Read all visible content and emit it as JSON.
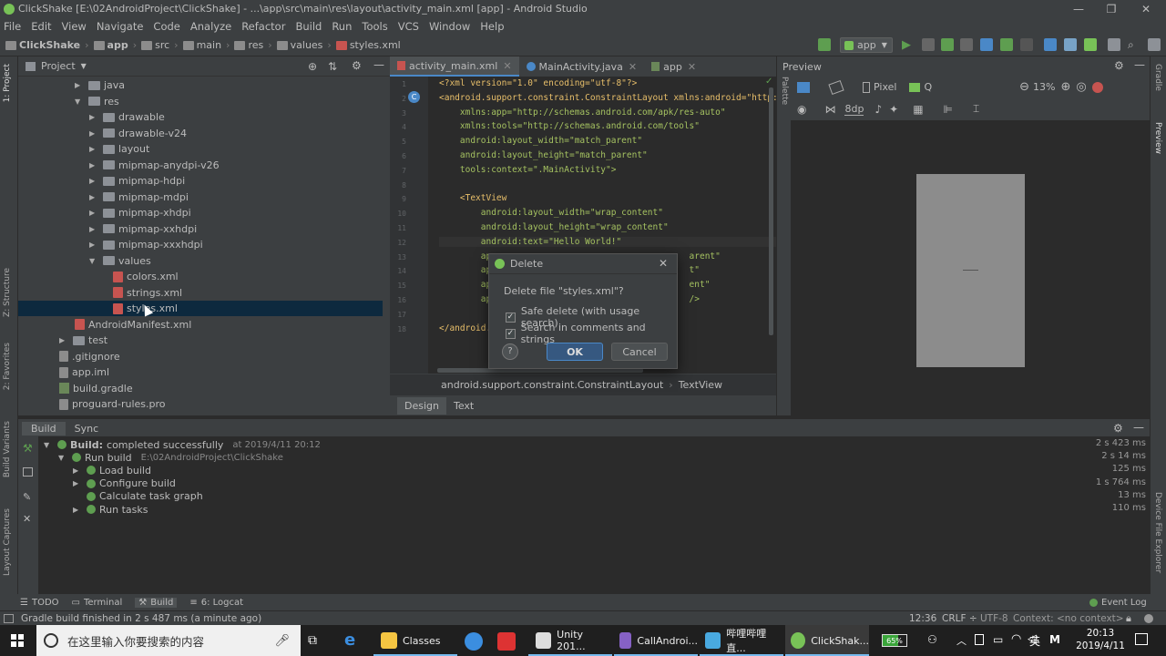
{
  "window": {
    "title": "ClickShake [E:\\02AndroidProject\\ClickShake] - ...\\app\\src\\main\\res\\layout\\activity_main.xml [app] - Android Studio",
    "minimize": "—",
    "maximize": "❐",
    "close": "✕"
  },
  "menu": [
    "File",
    "Edit",
    "View",
    "Navigate",
    "Code",
    "Analyze",
    "Refactor",
    "Build",
    "Run",
    "Tools",
    "VCS",
    "Window",
    "Help"
  ],
  "breadcrumbs": [
    "ClickShake",
    "app",
    "src",
    "main",
    "res",
    "values",
    "styles.xml"
  ],
  "run_config": "app",
  "project_panel": {
    "title": "Project",
    "tree": [
      {
        "label": "java",
        "kind": "folder",
        "depth": 4,
        "expanded": false
      },
      {
        "label": "res",
        "kind": "folder",
        "depth": 4,
        "expanded": true
      },
      {
        "label": "drawable",
        "kind": "folder",
        "depth": 5,
        "expanded": false
      },
      {
        "label": "drawable-v24",
        "kind": "folder",
        "depth": 5,
        "expanded": false
      },
      {
        "label": "layout",
        "kind": "folder",
        "depth": 5,
        "expanded": false
      },
      {
        "label": "mipmap-anydpi-v26",
        "kind": "folder",
        "depth": 5,
        "expanded": false
      },
      {
        "label": "mipmap-hdpi",
        "kind": "folder",
        "depth": 5,
        "expanded": false
      },
      {
        "label": "mipmap-mdpi",
        "kind": "folder",
        "depth": 5,
        "expanded": false
      },
      {
        "label": "mipmap-xhdpi",
        "kind": "folder",
        "depth": 5,
        "expanded": false
      },
      {
        "label": "mipmap-xxhdpi",
        "kind": "folder",
        "depth": 5,
        "expanded": false
      },
      {
        "label": "mipmap-xxxhdpi",
        "kind": "folder",
        "depth": 5,
        "expanded": false
      },
      {
        "label": "values",
        "kind": "folder",
        "depth": 5,
        "expanded": true
      },
      {
        "label": "colors.xml",
        "kind": "xml",
        "depth": 6
      },
      {
        "label": "strings.xml",
        "kind": "xml",
        "depth": 6
      },
      {
        "label": "styles.xml",
        "kind": "xml",
        "depth": 6,
        "selected": true
      },
      {
        "label": "AndroidManifest.xml",
        "kind": "xml",
        "depth": 4
      },
      {
        "label": "test",
        "kind": "folder",
        "depth": 3,
        "expanded": false
      },
      {
        "label": ".gitignore",
        "kind": "file",
        "depth": 2
      },
      {
        "label": "app.iml",
        "kind": "file",
        "depth": 2
      },
      {
        "label": "build.gradle",
        "kind": "gradle",
        "depth": 2
      },
      {
        "label": "proguard-rules.pro",
        "kind": "file",
        "depth": 2
      }
    ]
  },
  "editor": {
    "tabs": [
      {
        "label": "activity_main.xml",
        "active": true
      },
      {
        "label": "MainActivity.java",
        "active": false
      },
      {
        "label": "app",
        "active": false
      }
    ],
    "line_numbers": [
      "1",
      "2",
      "3",
      "4",
      "5",
      "6",
      "7",
      "8",
      "9",
      "10",
      "11",
      "12",
      "13",
      "14",
      "15",
      "16",
      "17",
      "18"
    ],
    "lines": [
      "<?xml version=\"1.0\" encoding=\"utf-8\"?>",
      "<android.support.constraint.ConstraintLayout xmlns:android=\"http://sc",
      "    xmlns:app=\"http://schemas.android.com/apk/res-auto\"",
      "    xmlns:tools=\"http://schemas.android.com/tools\"",
      "    android:layout_width=\"match_parent\"",
      "    android:layout_height=\"match_parent\"",
      "    tools:context=\".MainActivity\">",
      "",
      "    <TextView",
      "        android:layout_width=\"wrap_content\"",
      "        android:layout_height=\"wrap_content\"",
      "        android:text=\"Hello World!\"",
      "        ap                                      arent\"",
      "        ap                                      t\"",
      "        ap                                      ent\"",
      "        ap                                      />",
      "",
      "</android."
    ],
    "crumbs": [
      "android.support.constraint.ConstraintLayout",
      "TextView"
    ],
    "mode_tabs": [
      {
        "label": "Design",
        "active": true
      },
      {
        "label": "Text",
        "active": false
      }
    ]
  },
  "preview": {
    "title": "Preview",
    "device": "Pixel",
    "api": "Q",
    "zoom": "13%",
    "margin": "8dp"
  },
  "build_panel": {
    "tabs": [
      {
        "label": "Build",
        "active": true
      },
      {
        "label": "Sync",
        "active": false
      }
    ],
    "rows": [
      {
        "label": "Build:",
        "detail": "completed successfully",
        "extra": "at 2019/4/11 20:12",
        "time": "2 s 423 ms",
        "depth": 0,
        "expandable": true
      },
      {
        "label": "Run build",
        "detail": "",
        "extra": "E:\\02AndroidProject\\ClickShake",
        "time": "2 s 14 ms",
        "depth": 1,
        "expandable": true
      },
      {
        "label": "Load build",
        "detail": "",
        "extra": "",
        "time": "125 ms",
        "depth": 2,
        "expandable": true
      },
      {
        "label": "Configure build",
        "detail": "",
        "extra": "",
        "time": "1 s 764 ms",
        "depth": 2,
        "expandable": true
      },
      {
        "label": "Calculate task graph",
        "detail": "",
        "extra": "",
        "time": "13 ms",
        "depth": 2,
        "expandable": false
      },
      {
        "label": "Run tasks",
        "detail": "",
        "extra": "",
        "time": "110 ms",
        "depth": 2,
        "expandable": true
      }
    ]
  },
  "bottom_tabs": [
    {
      "label": "TODO",
      "active": false
    },
    {
      "label": "Terminal",
      "active": false
    },
    {
      "label": "Build",
      "active": true
    },
    {
      "label": "6: Logcat",
      "active": false
    }
  ],
  "event_log": "Event Log",
  "status": {
    "message": "Gradle build finished in 2 s 487 ms (a minute ago)",
    "position": "12:36",
    "line_sep": "CRLF ÷",
    "encoding": "UTF-8",
    "context": "Context: <no context>"
  },
  "side_labels": {
    "left": [
      "1: Project",
      "Z: Structure",
      "2: Favorites",
      "Build Variants",
      "Layout Captures"
    ],
    "right": [
      "Gradle",
      "Preview",
      "Device File Explorer"
    ],
    "palette": "Palette"
  },
  "dialog": {
    "title": "Delete",
    "message": "Delete file \"styles.xml\"?",
    "option1": "Safe delete (with usage search)",
    "option2": "Search in comments and strings",
    "option1_checked": true,
    "option2_checked": true,
    "help": "?",
    "ok": "OK",
    "cancel": "Cancel",
    "close": "✕"
  },
  "taskbar": {
    "search_placeholder": "在这里输入你要搜索的内容",
    "apps": [
      {
        "label": "Classes",
        "color": "#f5c542"
      },
      {
        "label": "Unity 201...",
        "color": "#dddddd"
      },
      {
        "label": "CallAndroi...",
        "color": "#8661c5"
      },
      {
        "label": "哔哩哔哩直...",
        "color": "#49a9e0"
      },
      {
        "label": "ClickShak...",
        "color": "#78c257"
      }
    ],
    "battery": "65%",
    "ime": "英",
    "time": "20:13",
    "date": "2019/4/11"
  },
  "colors": {
    "accent": "#4a88c7",
    "selection": "#0d293e",
    "ok_button": "#365880",
    "success": "#5e9e50"
  }
}
